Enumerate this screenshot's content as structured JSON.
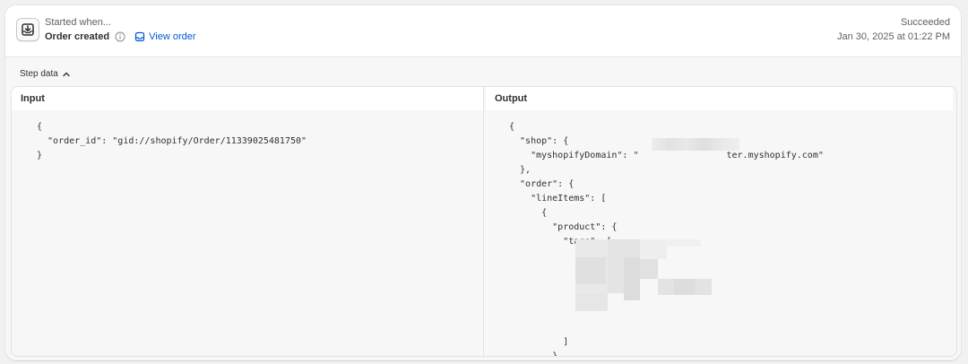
{
  "header": {
    "started_label": "Started when...",
    "trigger_name": "Order created",
    "view_order_label": "View order",
    "status": "Succeeded",
    "run_time": "Jan 30, 2025 at 01:22 PM"
  },
  "step_data": {
    "toggle_label": "Step data"
  },
  "input_panel": {
    "title": "Input",
    "code": "{\n  \"order_id\": \"gid://shopify/Order/11339025481750\"\n}"
  },
  "output_panel": {
    "title": "Output",
    "code_part1": "{\n  \"shop\": {\n    \"myshopifyDomain\": \"",
    "code_part2": "ter.myshopify.com\"\n  },\n  \"order\": {\n    \"lineItems\": [\n      {\n        \"product\": {\n          \"tags\": [\n\n\n\n\n\n\n          ]\n        }\n      ,"
  },
  "colors": {
    "link": "#005bd3",
    "page_bg": "#f1f1f1",
    "panel_bg": "#f7f7f7"
  },
  "icons": {
    "trigger": "download-tray-icon",
    "info": "info-circle-icon",
    "view_order": "order-icon",
    "toggle": "chevron-up-icon"
  }
}
